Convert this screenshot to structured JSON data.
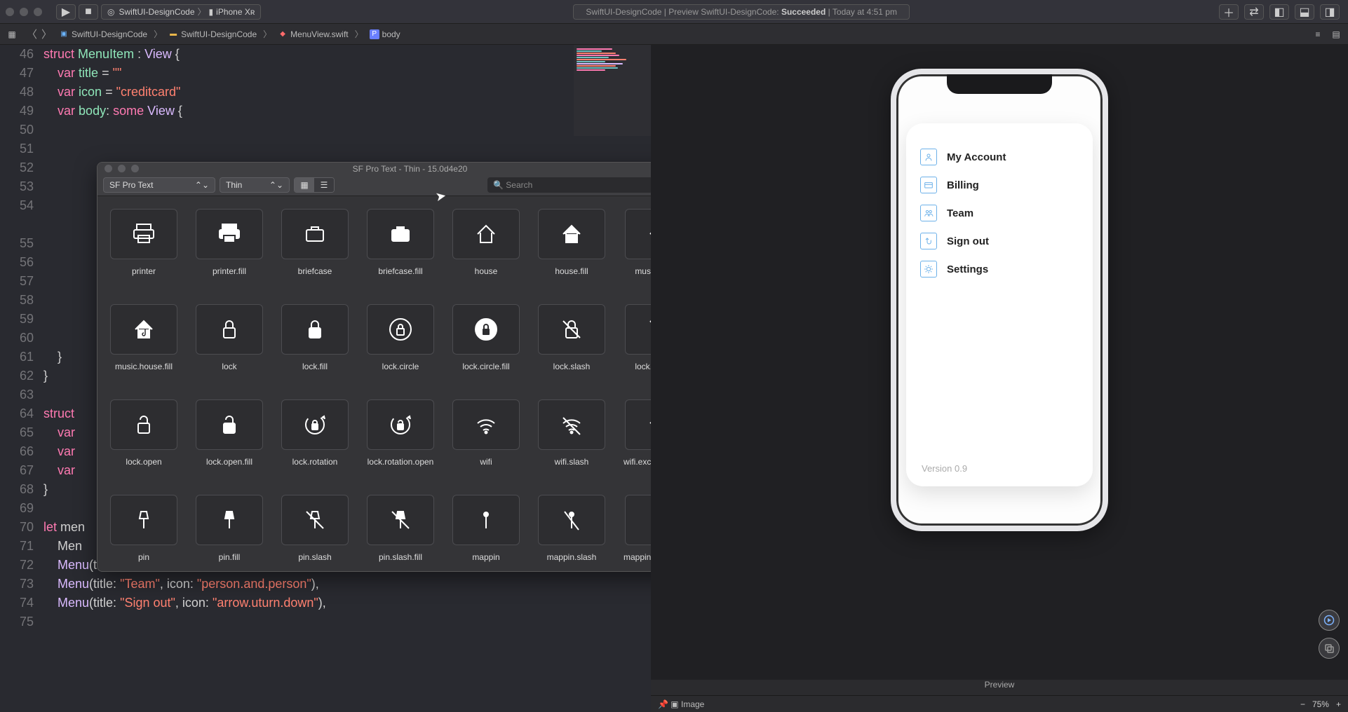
{
  "toolbar": {
    "scheme_project": "SwiftUI-DesignCode",
    "scheme_device": "iPhone Xʀ",
    "status_prefix": "SwiftUI-DesignCode | Preview SwiftUI-DesignCode:",
    "status_state": "Succeeded",
    "status_time": "| Today at 4:51 pm"
  },
  "jumpbar": {
    "project": "SwiftUI-DesignCode",
    "folder": "SwiftUI-DesignCode",
    "file": "MenuView.swift",
    "symbol": "body"
  },
  "gutter_lines": [
    "46",
    "47",
    "48",
    "49",
    "50",
    "51",
    "52",
    "53",
    "54",
    "",
    "55",
    "56",
    "57",
    "58",
    "59",
    "60",
    "61",
    "62",
    "63",
    "64",
    "65",
    "66",
    "67",
    "68",
    "69",
    "70",
    "71",
    "72",
    "73",
    "74",
    "75"
  ],
  "code": {
    "l46_struct": "struct",
    "l46_name": "MenuItem",
    "l46_colon": " : ",
    "l46_type": "View",
    "l46_brace": " {",
    "l47_var": "var",
    "l47_title": "title",
    "l47_eq": " = ",
    "l47_val": "\"\"",
    "l48_var": "var",
    "l48_icon": "icon",
    "l48_eq": " = ",
    "l48_val": "\"creditcard\"",
    "l49_var": "var",
    "l49_body": "body",
    "l49_colon": ": ",
    "l49_some": "some",
    "l49_view": "View",
    "l49_brace": " {",
    "l62": "    }",
    "l63": "}",
    "l65_struct": "struct",
    "l66_var": "var",
    "l67_var": "var",
    "l68_var": "var",
    "l69": "}",
    "l71_let": "let",
    "l71_men": "men",
    "l72_menu": "Men",
    "l73": "Menu(title: \"Billing\", icon: \"creditcard\"),",
    "l74": "Menu(title: \"Team\", icon: \"person.and.person\"),",
    "l75": "Menu(title: \"Sign out\", icon: \"arrow.uturn.down\"),"
  },
  "sfpanel": {
    "title": "SF Pro Text - Thin - 15.0d4e20",
    "font": "SF Pro Text",
    "weight": "Thin",
    "search_placeholder": "Search",
    "icons": [
      {
        "name": "printer",
        "glyph": "printer"
      },
      {
        "name": "printer.fill",
        "glyph": "printer-fill"
      },
      {
        "name": "briefcase",
        "glyph": "briefcase"
      },
      {
        "name": "briefcase.fill",
        "glyph": "briefcase-fill"
      },
      {
        "name": "house",
        "glyph": "house"
      },
      {
        "name": "house.fill",
        "glyph": "house-fill"
      },
      {
        "name": "music.house",
        "glyph": "music-house"
      },
      {
        "name": "music.house.fill",
        "glyph": "music-house-fill"
      },
      {
        "name": "lock",
        "glyph": "lock"
      },
      {
        "name": "lock.fill",
        "glyph": "lock-fill"
      },
      {
        "name": "lock.circle",
        "glyph": "lock-circle"
      },
      {
        "name": "lock.circle.fill",
        "glyph": "lock-circle-fill"
      },
      {
        "name": "lock.slash",
        "glyph": "lock-slash"
      },
      {
        "name": "lock.slash.fill",
        "glyph": "lock-slash-fill"
      },
      {
        "name": "lock.open",
        "glyph": "lock-open"
      },
      {
        "name": "lock.open.fill",
        "glyph": "lock-open-fill"
      },
      {
        "name": "lock.rotation",
        "glyph": "lock-rotation"
      },
      {
        "name": "lock.rotation.open",
        "glyph": "lock-rotation-open"
      },
      {
        "name": "wifi",
        "glyph": "wifi"
      },
      {
        "name": "wifi.slash",
        "glyph": "wifi-slash"
      },
      {
        "name": "wifi.exclamationm…",
        "glyph": "wifi-excl"
      },
      {
        "name": "pin",
        "glyph": "pin"
      },
      {
        "name": "pin.fill",
        "glyph": "pin-fill"
      },
      {
        "name": "pin.slash",
        "glyph": "pin-slash"
      },
      {
        "name": "pin.slash.fill",
        "glyph": "pin-slash-fill"
      },
      {
        "name": "mappin",
        "glyph": "mappin"
      },
      {
        "name": "mappin.slash",
        "glyph": "mappin-slash"
      },
      {
        "name": "mappin.and.ellipse",
        "glyph": "mappin-ellipse"
      }
    ]
  },
  "preview": {
    "menu": [
      {
        "label": "My Account",
        "icon": "person"
      },
      {
        "label": "Billing",
        "icon": "creditcard"
      },
      {
        "label": "Team",
        "icon": "people"
      },
      {
        "label": "Sign out",
        "icon": "uturn"
      },
      {
        "label": "Settings",
        "icon": "gear"
      }
    ],
    "version": "Version 0.9",
    "tab": "Preview",
    "image_label": "Image",
    "zoom": "75%"
  }
}
